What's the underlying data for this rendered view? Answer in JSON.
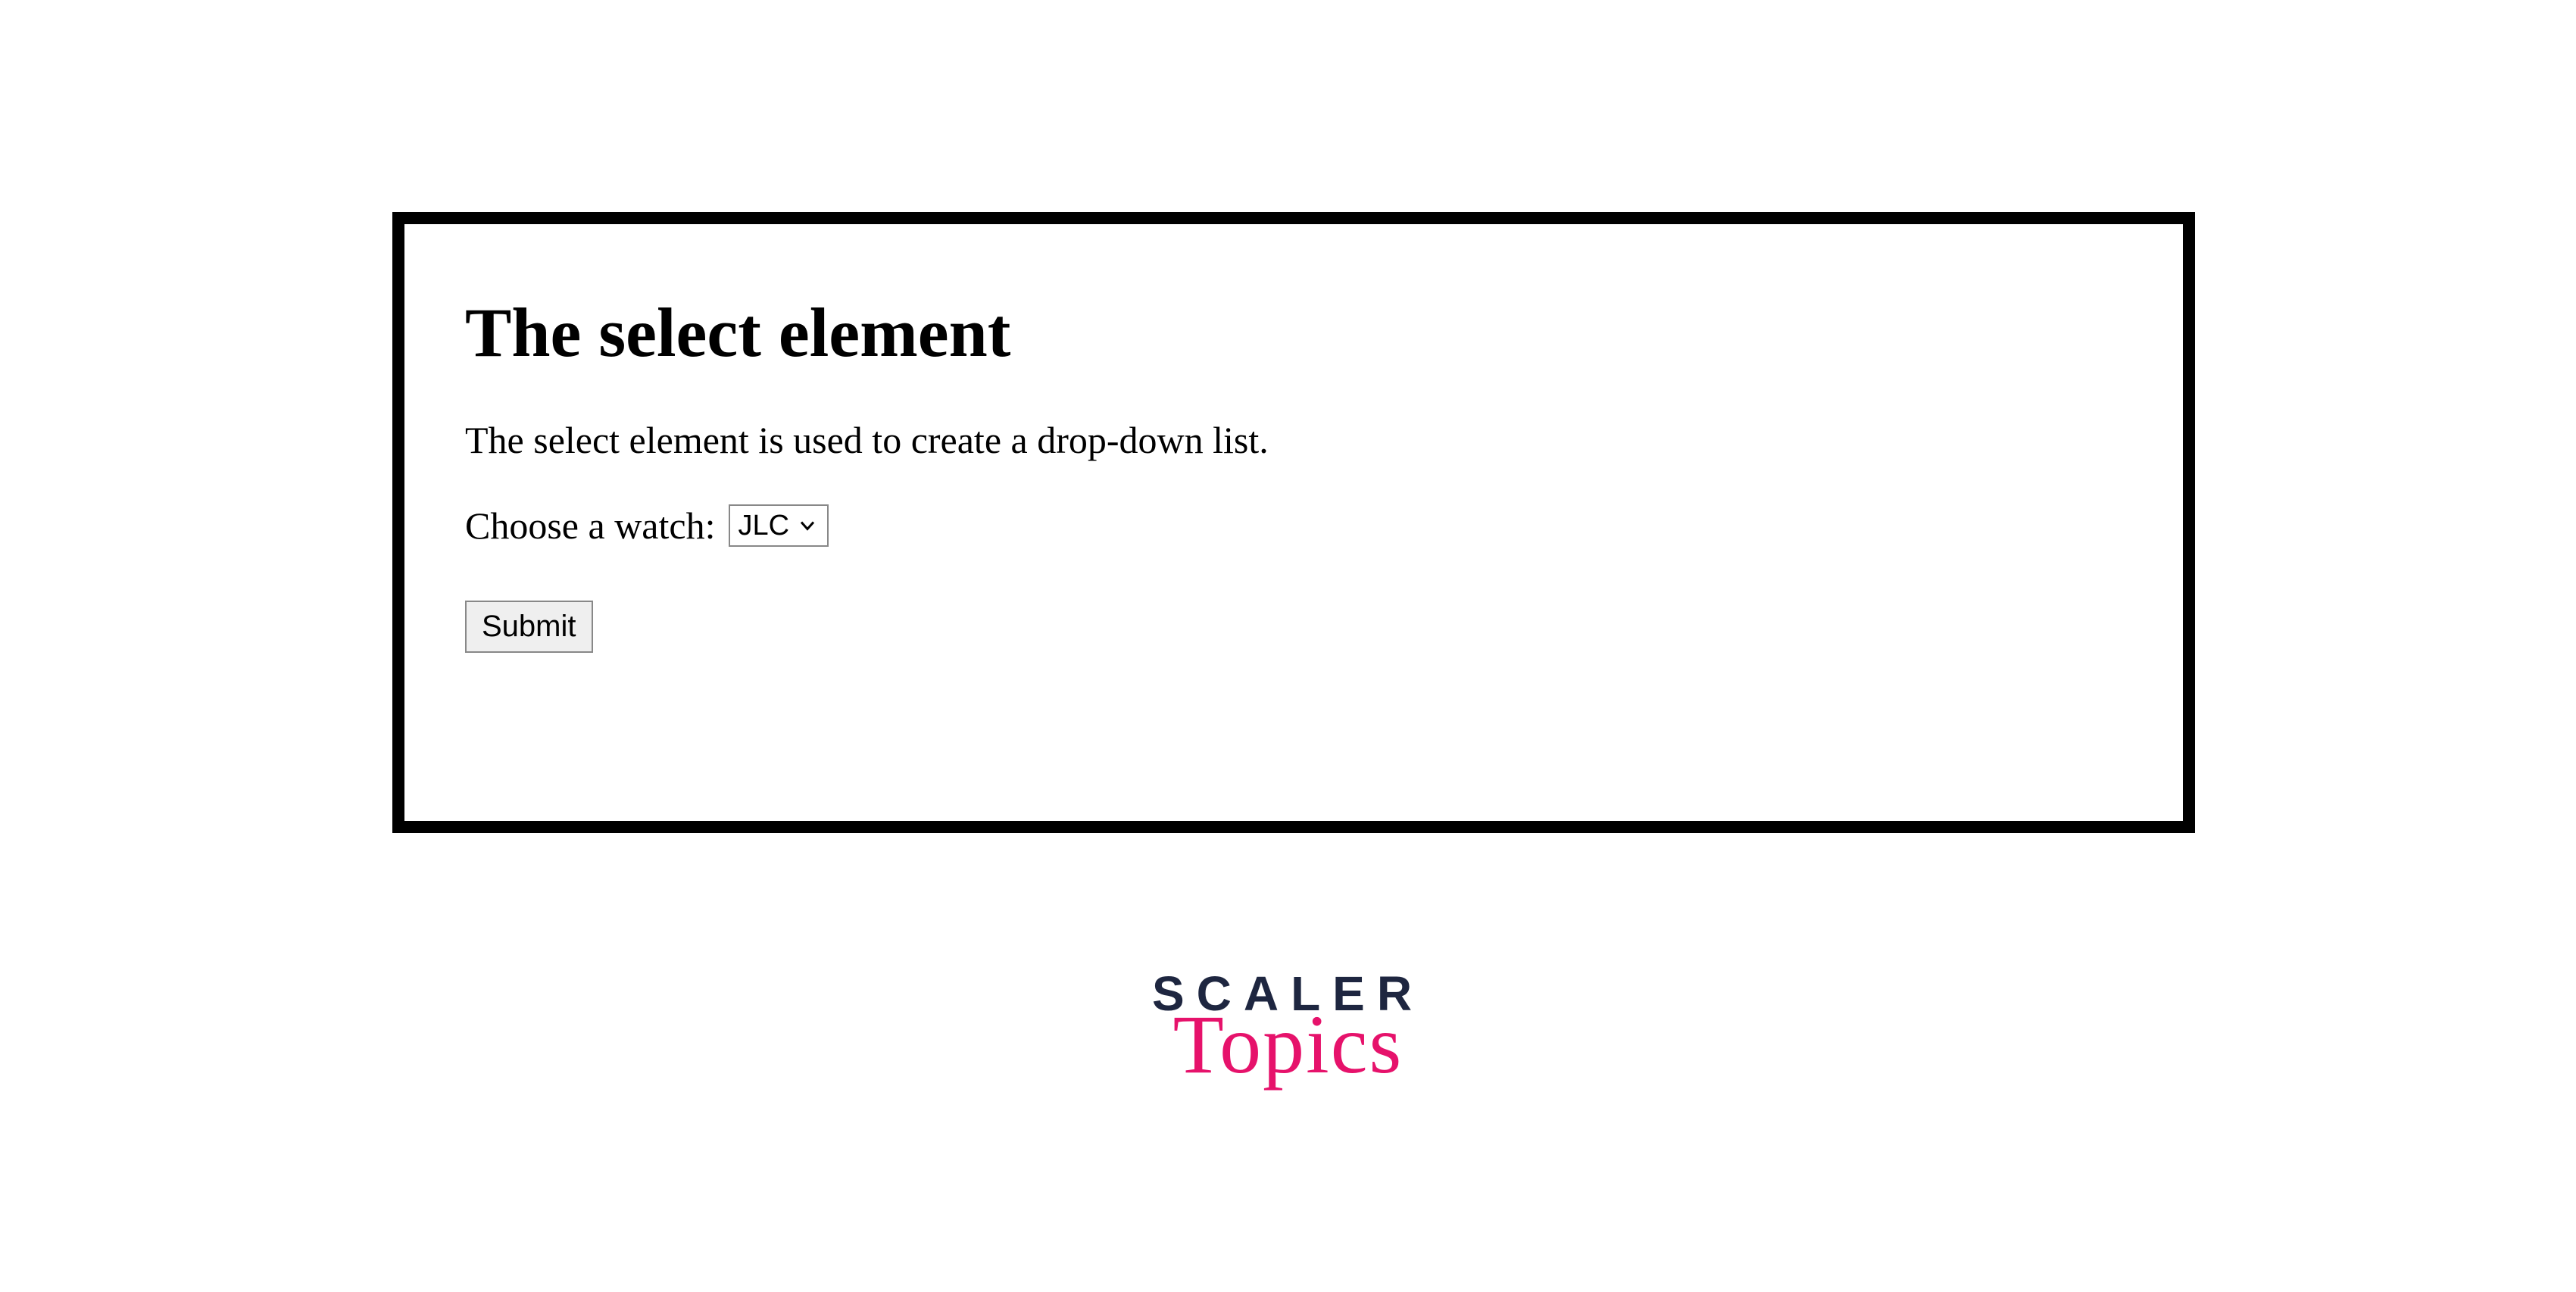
{
  "heading": "The select element",
  "description": "The select element is used to create a drop-down list.",
  "form": {
    "label": "Choose a watch:",
    "select_value": "JLC",
    "submit_label": "Submit"
  },
  "logo": {
    "line1": "SCALER",
    "line2": "Topics"
  }
}
